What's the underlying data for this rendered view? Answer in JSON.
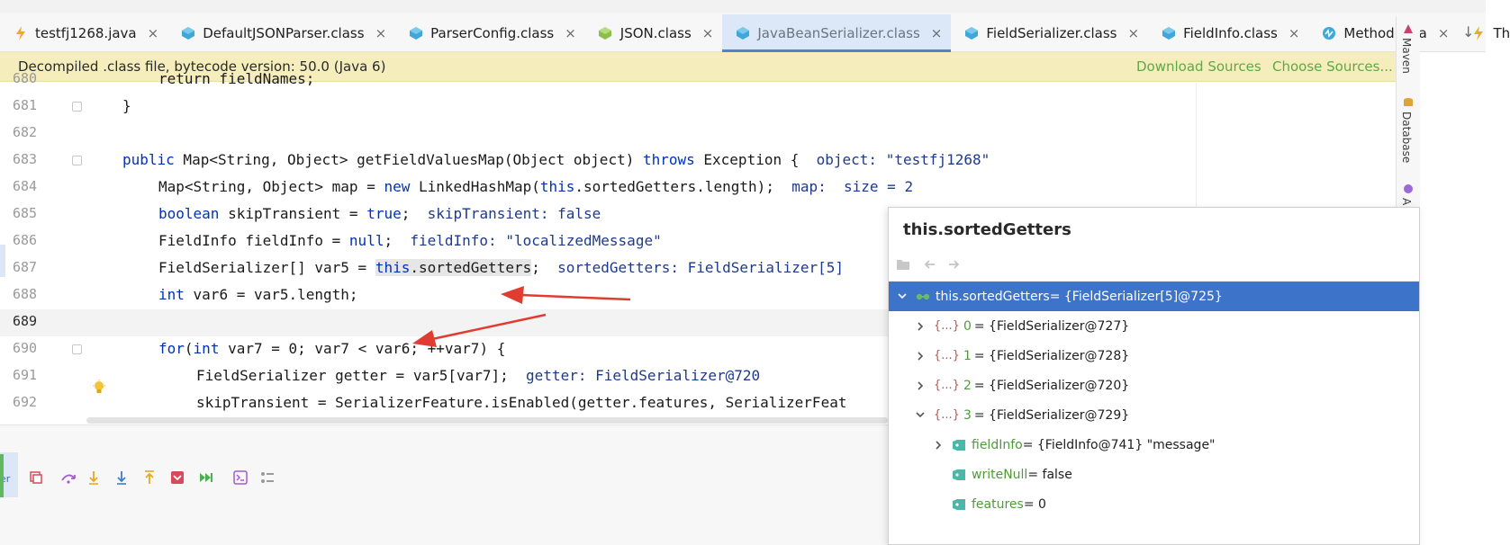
{
  "tabs": [
    {
      "label": "testfj1268.java",
      "icon": "java-run-icon",
      "active": false
    },
    {
      "label": "DefaultJSONParser.class",
      "icon": "class-file-icon",
      "active": false
    },
    {
      "label": "ParserConfig.class",
      "icon": "class-file-icon",
      "active": false
    },
    {
      "label": "JSON.class",
      "icon": "class-green-icon",
      "active": false
    },
    {
      "label": "JavaBeanSerializer.class",
      "icon": "class-file-icon",
      "active": true
    },
    {
      "label": "FieldSerializer.class",
      "icon": "class-file-icon",
      "active": false
    },
    {
      "label": "FieldInfo.class",
      "icon": "class-file-icon",
      "active": false
    },
    {
      "label": "Method.java",
      "icon": "java-file-icon",
      "active": false
    },
    {
      "label": "Throwable.ja",
      "icon": "java-run-icon",
      "active": false
    }
  ],
  "tab_close_glyph": "×",
  "tab_scroll_glyph": "↓",
  "notice": {
    "text": "Decompiled .class file, bytecode version: 50.0 (Java 6)",
    "download": "Download Sources",
    "choose": "Choose Sources..."
  },
  "right_strip": {
    "maven": "Maven",
    "database": "Database",
    "letter": "A"
  },
  "code_lines": [
    {
      "num": "680",
      "code": "return fieldNames;"
    },
    {
      "num": "681",
      "code": "}"
    },
    {
      "num": "682",
      "code": ""
    },
    {
      "num": "683",
      "kw1": "public",
      "code": " Map<String, Object> getFieldValuesMap(Object object) ",
      "kw2": "throws",
      "code2": " Exception {",
      "inline": "  object: \"testfj1268\""
    },
    {
      "num": "684",
      "code": "Map<String, Object> map = ",
      "kw1": "new",
      "code2": " LinkedHashMap(",
      "kw2": "this",
      "code3": ".sortedGetters.length);",
      "inline": "  map:  size = 2"
    },
    {
      "num": "685",
      "kw1": "boolean",
      "code": " skipTransient = ",
      "kw2": "true",
      "code2": ";",
      "inline": "  skipTransient: false"
    },
    {
      "num": "686",
      "code": "FieldInfo fieldInfo = ",
      "kw1": "null",
      "code2": ";",
      "inline": "  fieldInfo: \"localizedMessage\""
    },
    {
      "num": "687",
      "code": "FieldSerializer[] var5 = ",
      "kw1": "this",
      "hl": ".sortedGetters",
      "code2": ";",
      "inline": "  sortedGetters: FieldSerializer[5]"
    },
    {
      "num": "688",
      "kw1": "int",
      "code": " var6 = var5.length;"
    },
    {
      "num": "689",
      "code": ""
    },
    {
      "num": "690",
      "kw1": "for",
      "code": "(",
      "kw2": "int",
      "code2": " var7 = 0; var7 < var6; ++var7) {"
    },
    {
      "num": "691",
      "code": "FieldSerializer getter = var5[var7];",
      "inline": "  getter: FieldSerializer@720"
    },
    {
      "num": "692",
      "code": "skipTransient = SerializerFeature.isEnabled(getter.features, SerializerFeat"
    }
  ],
  "popup": {
    "title": "this.sortedGetters",
    "root": {
      "name": "this.sortedGetters",
      "value": " = {FieldSerializer[5]@725}"
    },
    "items": [
      {
        "index": "0",
        "value": " = {FieldSerializer@727}"
      },
      {
        "index": "1",
        "value": " = {FieldSerializer@728}"
      },
      {
        "index": "2",
        "value": " = {FieldSerializer@720}"
      },
      {
        "index": "3",
        "value": " = {FieldSerializer@729}"
      }
    ],
    "fields": [
      {
        "name": "fieldInfo",
        "value": " = {FieldInfo@741} \"message\""
      },
      {
        "name": "writeNull",
        "value": " = false"
      },
      {
        "name": "features",
        "value": " = 0"
      }
    ],
    "array_badge": "{...}"
  },
  "debug": {
    "side_label": "er"
  },
  "colors": {
    "accent": "#3d73c9",
    "notice_bg": "#f5eebc",
    "link": "#5fa845",
    "keyword": "#0033b3",
    "arrow": "#e03c31"
  }
}
